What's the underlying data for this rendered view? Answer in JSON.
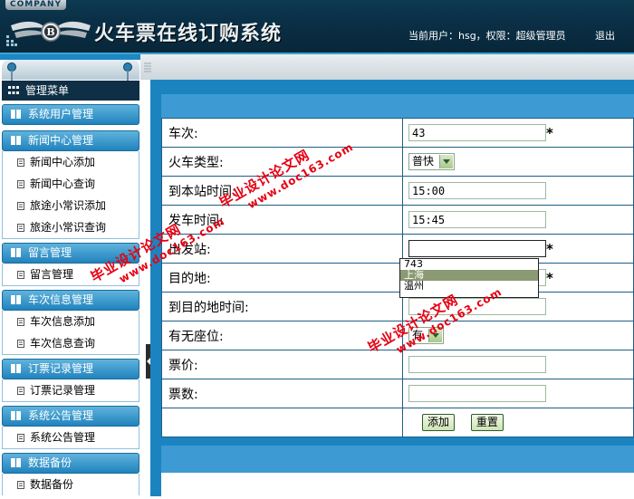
{
  "header": {
    "company": "COMPANY",
    "title": "火车票在线订购系统",
    "user_info": "当前用户：hsg，权限：超级管理员",
    "logout": "退出"
  },
  "sidebar": {
    "menu_title": "管理菜单",
    "sections": [
      {
        "title": "系统用户管理",
        "items": []
      },
      {
        "title": "新闻中心管理",
        "items": [
          "新闻中心添加",
          "新闻中心查询",
          "旅途小常识添加",
          "旅途小常识查询"
        ]
      },
      {
        "title": "留言管理",
        "items": [
          "留言管理"
        ]
      },
      {
        "title": "车次信息管理",
        "items": [
          "车次信息添加",
          "车次信息查询"
        ]
      },
      {
        "title": "订票记录管理",
        "items": [
          "订票记录管理"
        ]
      },
      {
        "title": "系统公告管理",
        "items": [
          "系统公告管理"
        ]
      },
      {
        "title": "数据备份",
        "items": [
          "数据备份"
        ]
      }
    ]
  },
  "form": {
    "fields": [
      {
        "label": "车次:",
        "type": "text",
        "value": "43",
        "required": "*"
      },
      {
        "label": "火车类型:",
        "type": "select",
        "value": "普快"
      },
      {
        "label": "到本站时间:",
        "type": "text",
        "value": "15:00"
      },
      {
        "label": "发车时间:",
        "type": "text",
        "value": "15:45"
      },
      {
        "label": "出发站:",
        "type": "text",
        "value": "",
        "required": "*"
      },
      {
        "label": "目的地:",
        "type": "text",
        "value": "",
        "required": "*"
      },
      {
        "label": "到目的地时间:",
        "type": "text",
        "value": ""
      },
      {
        "label": "有无座位:",
        "type": "select",
        "value": "有"
      },
      {
        "label": "票价:",
        "type": "text",
        "value": ""
      },
      {
        "label": "票数:",
        "type": "text",
        "value": ""
      }
    ],
    "add_button": "添加",
    "reset_button": "重置"
  },
  "suggestions": [
    "743",
    "上海",
    "温州"
  ],
  "watermark": {
    "line1": "毕业设计论文网",
    "line2": "www.doc163.com"
  },
  "colors": {
    "header_bg": "#0a2f46",
    "accent_blue": "#3d9ad2",
    "border": "#1f5f86",
    "watermark": "#e60012"
  }
}
